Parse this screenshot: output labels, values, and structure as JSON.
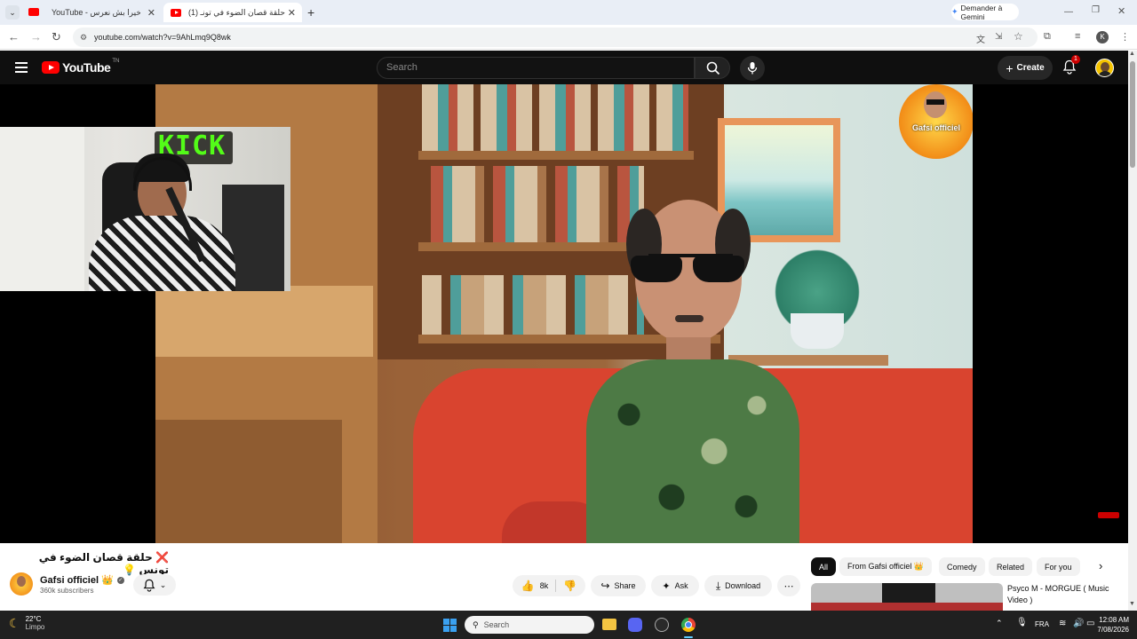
{
  "browser": {
    "tabs": [
      {
        "label": "YouTube - أخيرا بش نعرس 💍"
      },
      {
        "label": "(1) حلقة قصان الضوء في تونـ"
      }
    ],
    "gemini_label": "Demander à Gemini",
    "url": "youtube.com/watch?v=9AhLmq9Q8wk",
    "profile_initial": "K"
  },
  "youtube": {
    "logo_text": "YouTube",
    "logo_suffix": "TN",
    "search_placeholder": "Search",
    "create_label": "Create",
    "notification_count": "1"
  },
  "video": {
    "title": "❌ حلقة قصان الضوء في تونس 💡",
    "channel_name": "Gafsi officiel 👑",
    "subscribers": "360k subscribers",
    "likes": "8k",
    "share_label": "Share",
    "ask_label": "Ask",
    "download_label": "Download",
    "watermark_logo_text": "Gafsi officiel",
    "webcam_sign": "KICK"
  },
  "filters": [
    "All",
    "From Gafsi officiel 👑",
    "Comedy",
    "Related",
    "For you"
  ],
  "recommended": {
    "title": "Psyco M - MORGUE ( Music Video )"
  },
  "taskbar": {
    "weather_temp": "22°C",
    "weather_desc": "Limpo",
    "search_label": "Search",
    "language": "FRA",
    "time": "12:08 AM",
    "date": "7/08/2026"
  },
  "colors": {
    "youtube_red": "#ff0000",
    "header_bg": "#0f0f0f",
    "taskbar_bg": "#202020"
  }
}
